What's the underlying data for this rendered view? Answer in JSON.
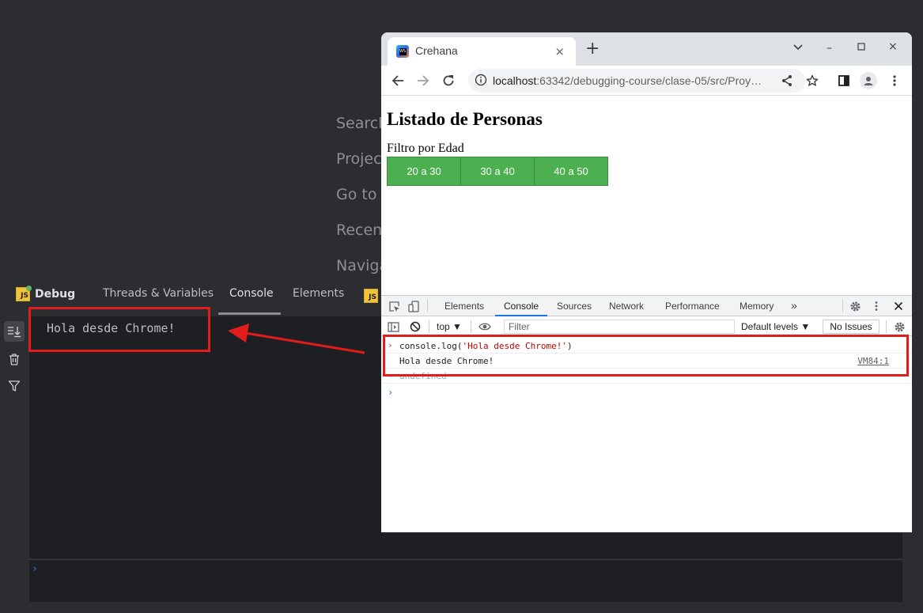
{
  "ide": {
    "welcome_hints": [
      "Search",
      "Project",
      "Go to",
      "Recen",
      "Naviga"
    ],
    "debug_tab_title": "Debug",
    "tabs": [
      "Threads & Variables",
      "Console",
      "Elements"
    ],
    "active_tab": "Console",
    "console_output": "Hola desde Chrome!",
    "input_prompt": "›"
  },
  "browser": {
    "tab_title": "Crehana",
    "tab_close": "×",
    "new_tab": "+",
    "url_host": "localhost",
    "url_rest": ":63342/debugging-course/clase-05/src/Proy…",
    "window_controls": {
      "dropdown": "⌄",
      "minimize": "–",
      "maximize": "☐",
      "close": "×"
    }
  },
  "page": {
    "heading": "Listado de Personas",
    "filter_label": "Filtro por Edad",
    "buttons": [
      "20 a 30",
      "30 a 40",
      "40 a 50"
    ],
    "button_color": "#4caf50"
  },
  "devtools": {
    "tabs": [
      "Elements",
      "Console",
      "Sources",
      "Network",
      "Performance",
      "Memory"
    ],
    "more_tabs": "»",
    "active_tab": "Console",
    "context": "top ▼",
    "filter_placeholder": "Filter",
    "levels": "Default levels ▼",
    "issues": "No Issues",
    "messages": {
      "input_prefix": "console.log(",
      "input_string": "'Hola desde Chrome!'",
      "input_suffix": ")",
      "output": "Hola desde Chrome!",
      "output_source": "VM84:1",
      "return_value": "undefined"
    },
    "prompt": "›"
  },
  "annotation": {
    "highlight_color": "#e01c1c"
  }
}
